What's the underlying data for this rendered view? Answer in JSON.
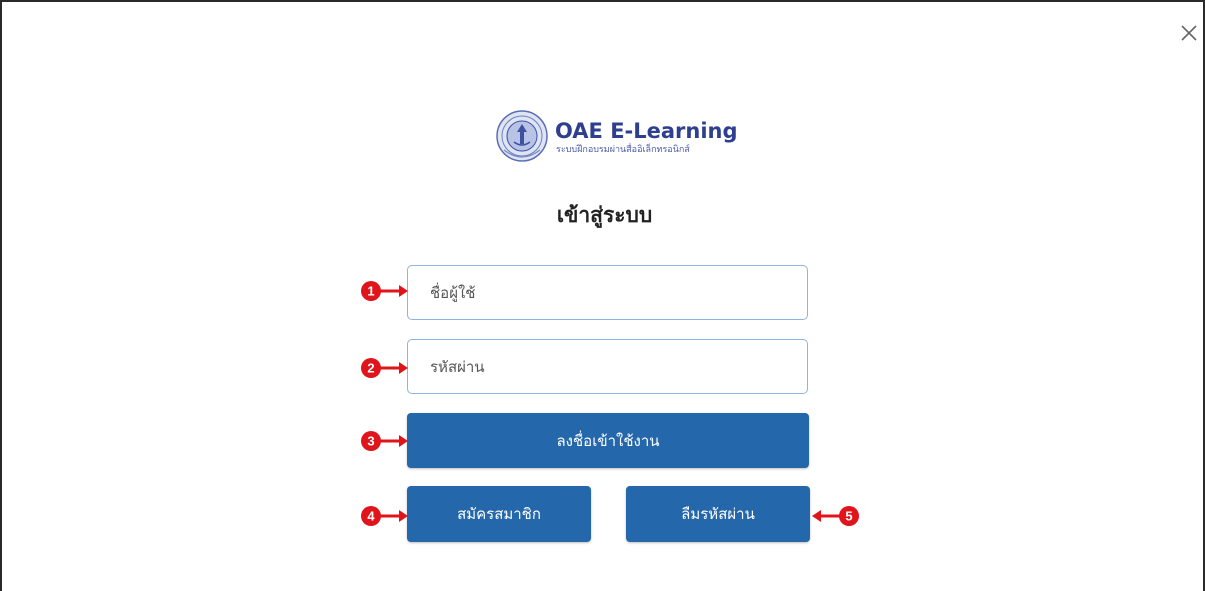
{
  "modal": {
    "close_icon": "close-icon"
  },
  "logo": {
    "emblem_icon": "oae-emblem-icon",
    "title": "OAE E-Learning",
    "subtitle": "ระบบฝึกอบรมผ่านสื่ออิเล็กทรอนิกส์"
  },
  "form": {
    "heading": "เข้าสู่ระบบ",
    "username_placeholder": "ชื่อผู้ใช้",
    "username_value": "",
    "password_placeholder": "รหัสผ่าน",
    "password_value": "",
    "login_label": "ลงชื่อเข้าใช้งาน",
    "register_label": "สมัครสมาชิก",
    "forgot_label": "ลืมรหัสผ่าน"
  },
  "callouts": {
    "c1": "1",
    "c2": "2",
    "c3": "3",
    "c4": "4",
    "c5": "5"
  },
  "colors": {
    "primary_button": "#2467ab",
    "logo_text": "#2e3f8f",
    "input_border": "#8fb4e0",
    "callout_red": "#e0141b"
  }
}
